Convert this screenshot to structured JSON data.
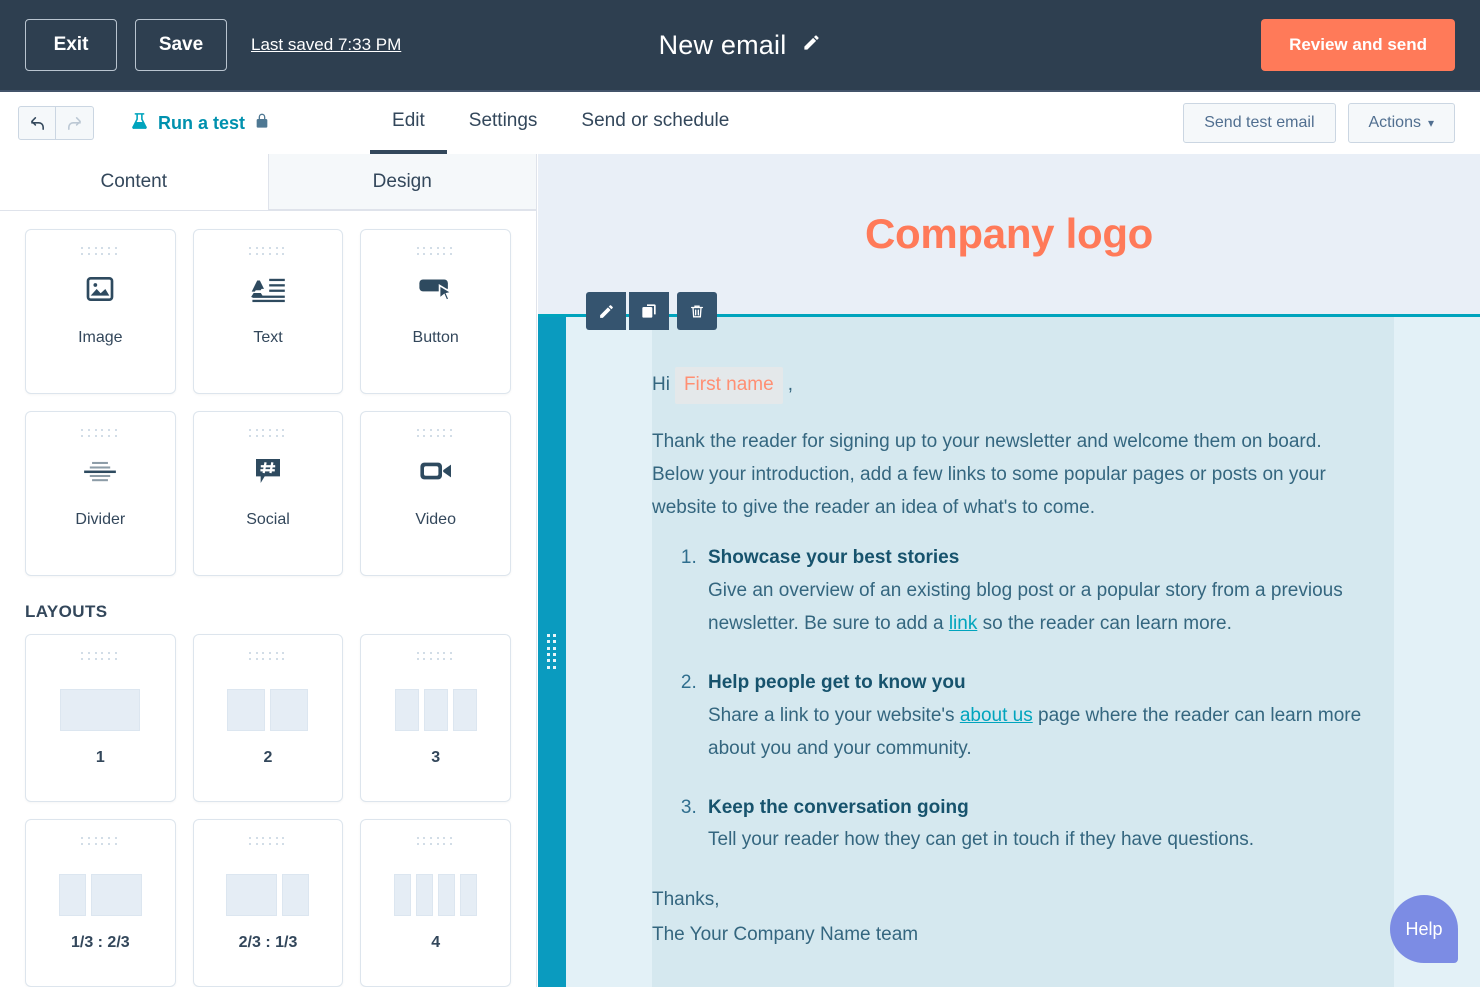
{
  "topbar": {
    "exit_label": "Exit",
    "save_label": "Save",
    "last_saved": "Last saved 7:33 PM",
    "title": "New email",
    "edit_title_icon": "pencil-icon",
    "primary_action": "Review and send",
    "accent_color": "#FF7A59",
    "background_color": "#2E3F50"
  },
  "subbar": {
    "undo_icon": "undo-arrow-icon",
    "redo_icon": "redo-arrow-icon",
    "run_test_label": "Run a test",
    "run_test_icon": "flask-icon",
    "lock_icon": "lock-icon",
    "tabs": [
      {
        "label": "Edit",
        "active": true
      },
      {
        "label": "Settings",
        "active": false
      },
      {
        "label": "Send or schedule",
        "active": false
      }
    ],
    "send_test_label": "Send test email",
    "actions_label": "Actions",
    "actions_caret": "▾"
  },
  "sidebar": {
    "panel_tabs": [
      {
        "label": "Content",
        "active": true
      },
      {
        "label": "Design",
        "active": false
      }
    ],
    "blocks": [
      {
        "label": "Image",
        "icon": "image-icon"
      },
      {
        "label": "Text",
        "icon": "text-icon"
      },
      {
        "label": "Button",
        "icon": "button-icon"
      },
      {
        "label": "Divider",
        "icon": "divider-icon"
      },
      {
        "label": "Social",
        "icon": "social-hashtag-icon"
      },
      {
        "label": "Video",
        "icon": "video-camera-icon"
      }
    ],
    "layouts_title": "LAYOUTS",
    "layouts": [
      {
        "label": "1",
        "columns": [
          1
        ]
      },
      {
        "label": "2",
        "columns": [
          1,
          1
        ]
      },
      {
        "label": "3",
        "columns": [
          1,
          1,
          1
        ]
      },
      {
        "label": "1/3 : 2/3",
        "columns": [
          1,
          2
        ]
      },
      {
        "label": "2/3 : 1/3",
        "columns": [
          2,
          1
        ]
      },
      {
        "label": "4",
        "columns": [
          1,
          1,
          1,
          1
        ]
      }
    ]
  },
  "canvas": {
    "logo_text": "Company logo",
    "logo_color": "#FF7A59",
    "background_color": "#E9EFF7",
    "selection_color": "#00A4BD",
    "module_toolbar": [
      {
        "icon": "pencil-icon",
        "name": "edit-module-button"
      },
      {
        "icon": "copy-icon",
        "name": "duplicate-module-button"
      },
      {
        "icon": "trash-icon",
        "name": "delete-module-button"
      }
    ],
    "email": {
      "greeting_prefix": "Hi",
      "greeting_token": "First name",
      "greeting_suffix": ",",
      "intro": "Thank the reader for signing up to your newsletter and welcome them on board. Below your introduction, add a few links to some popular pages or posts on your website to give the reader an idea of what's to come.",
      "points": [
        {
          "heading": "Showcase your best stories",
          "body_before": "Give an overview of an existing blog post or a popular story from a previous newsletter. Be sure to add a ",
          "link": "link",
          "body_after": " so the reader can learn more."
        },
        {
          "heading": "Help people get to know you",
          "body_before": "Share a link to your website's ",
          "link": "about us",
          "body_after": " page where the reader can learn more about you and your community."
        },
        {
          "heading": "Keep the conversation going",
          "body_before": "Tell your reader how they can get in touch if they have questions.",
          "link": "",
          "body_after": ""
        }
      ],
      "sign_off": "Thanks,",
      "sign_team": "The Your Company Name team"
    }
  },
  "help": {
    "label": "Help",
    "color": "#7C8CE4"
  }
}
